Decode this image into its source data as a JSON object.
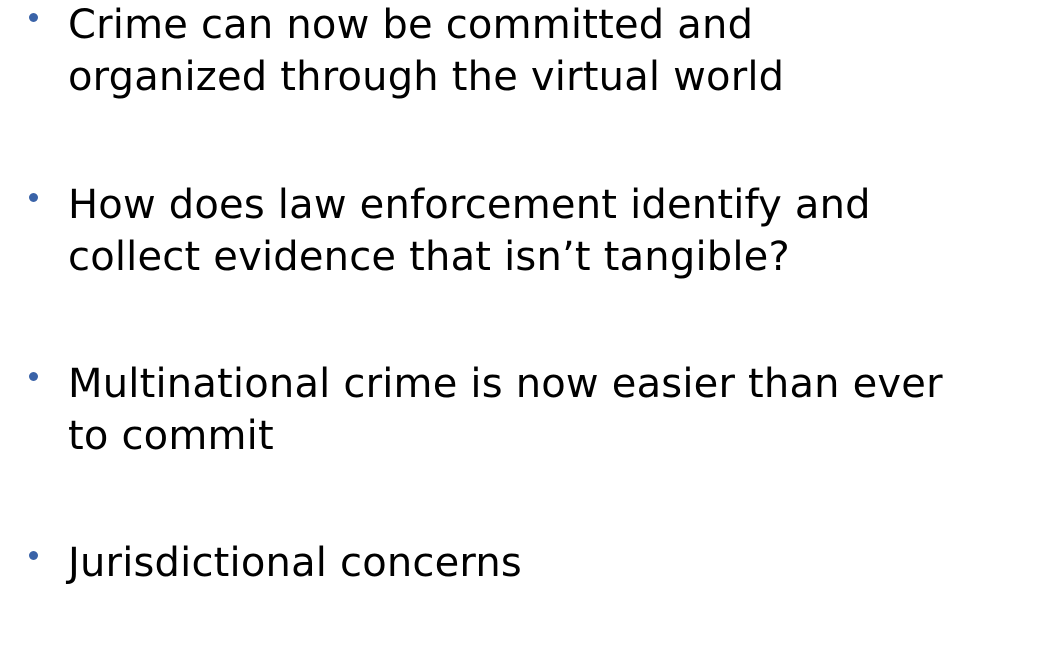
{
  "slide": {
    "bullet_color": "#3a63a8",
    "bullets": [
      {
        "line1": "Crime can now be committed and",
        "line2": "organized through the virtual world"
      },
      {
        "line1": "How does law enforcement identify and",
        "line2": "collect evidence that isn’t tangible?"
      },
      {
        "line1": "Multinational crime is now easier than ever",
        "line2": "to commit"
      },
      {
        "line1": "Jurisdictional concerns",
        "line2": ""
      }
    ]
  }
}
